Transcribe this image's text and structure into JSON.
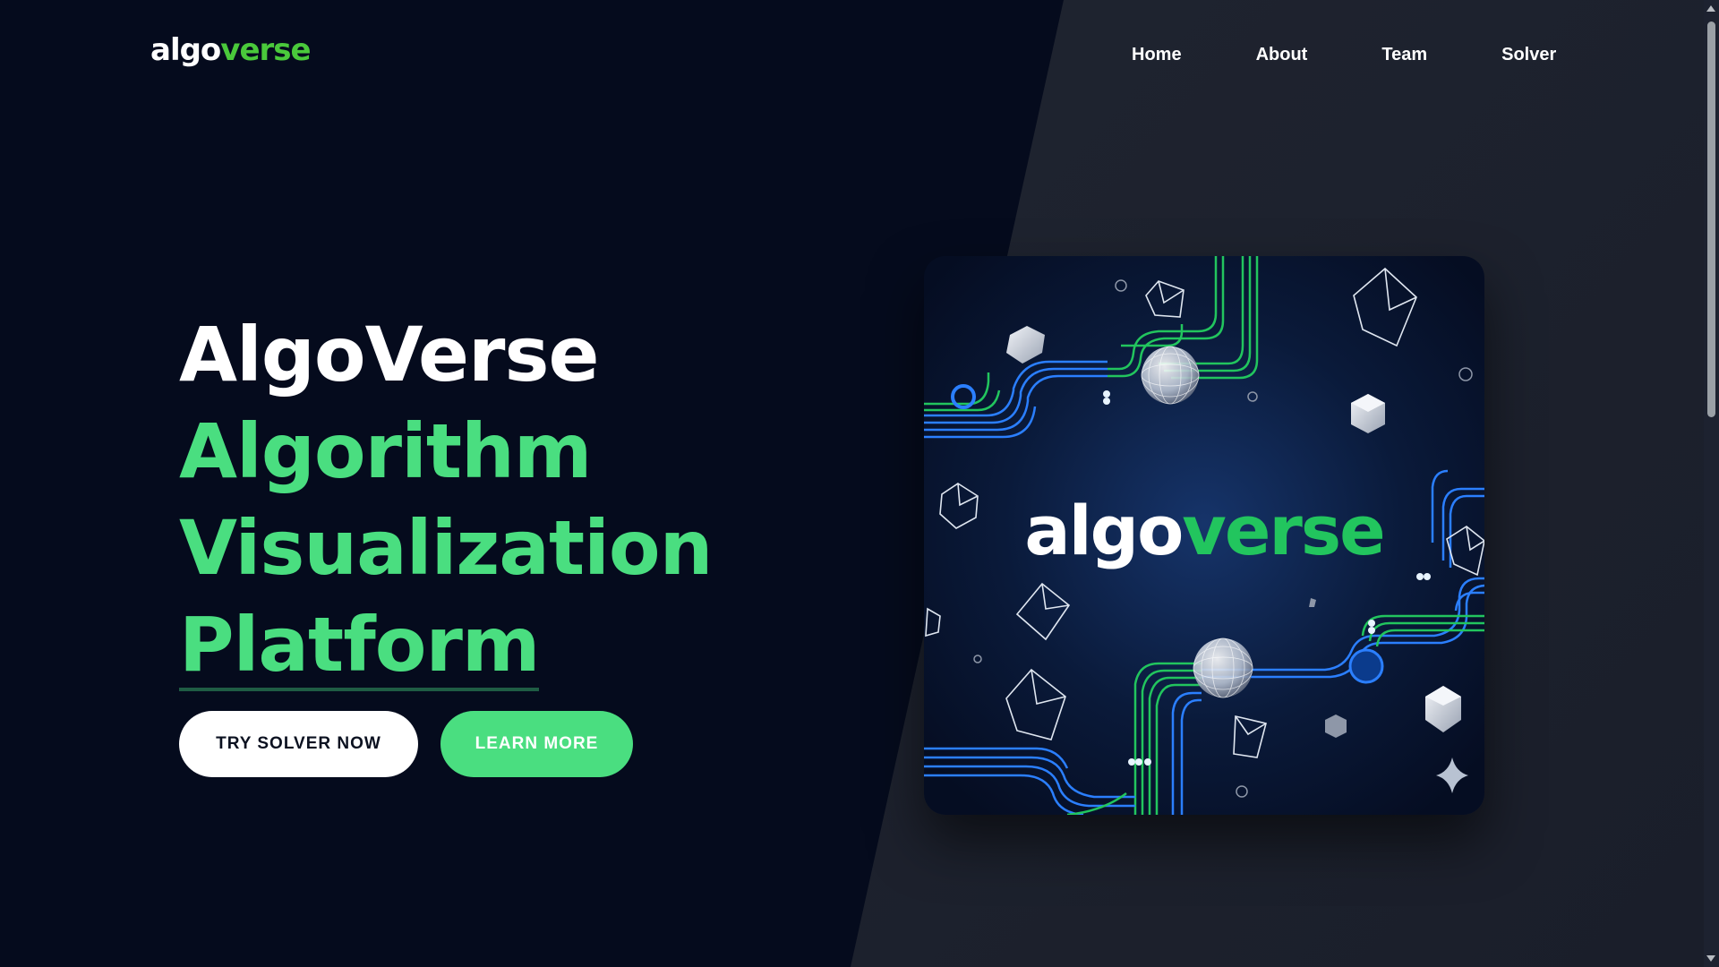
{
  "header": {
    "logo_part1": "algo",
    "logo_part2": "verse",
    "nav": [
      "Home",
      "About",
      "Team",
      "Solver"
    ]
  },
  "hero": {
    "title_line1": "AlgoVerse",
    "title_line2": "Algorithm",
    "title_line3": "Visualization",
    "title_line4": "Platform",
    "primary_button": "TRY SOLVER NOW",
    "secondary_button": "LEARN MORE"
  },
  "card": {
    "logo_part1": "algo",
    "logo_part2": "verse"
  },
  "colors": {
    "background": "#050b1d",
    "panel": "#1e2330",
    "accent_green": "#4ade80",
    "logo_green": "#4ac93b",
    "line_blue": "#2b7fff"
  }
}
